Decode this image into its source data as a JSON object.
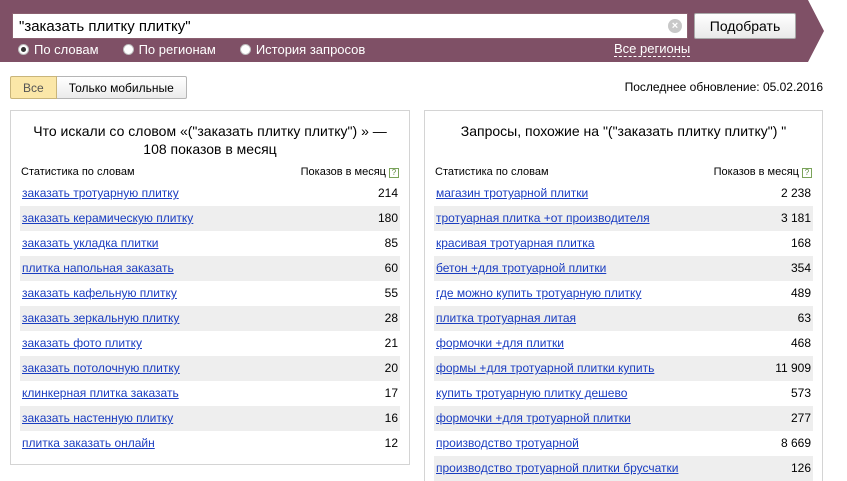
{
  "search": {
    "query": "\"заказать плитку плитку\"",
    "button_label": "Подобрать",
    "clear_glyph": "×"
  },
  "modes": [
    {
      "label": "По словам",
      "selected": true
    },
    {
      "label": "По регионам",
      "selected": false
    },
    {
      "label": "История запросов",
      "selected": false
    }
  ],
  "regions_link": "Все регионы",
  "filters": {
    "all_label": "Все",
    "mobile_label": "Только мобильные"
  },
  "last_update": "Последнее обновление: 05.02.2016",
  "left_panel": {
    "title": "Что искали со словом «(\"заказать плитку плитку\") » — 108 показов в месяц",
    "col_query": "Статистика по словам",
    "col_count": "Показов в месяц",
    "rows": [
      {
        "q": "заказать тротуарную плитку",
        "n": "214"
      },
      {
        "q": "заказать керамическую плитку",
        "n": "180"
      },
      {
        "q": "заказать укладка плитки",
        "n": "85"
      },
      {
        "q": "плитка напольная заказать",
        "n": "60"
      },
      {
        "q": "заказать кафельную плитку",
        "n": "55"
      },
      {
        "q": "заказать зеркальную плитку",
        "n": "28"
      },
      {
        "q": "заказать фото плитку",
        "n": "21"
      },
      {
        "q": "заказать потолочную плитку",
        "n": "20"
      },
      {
        "q": "клинкерная плитка заказать",
        "n": "17"
      },
      {
        "q": "заказать настенную плитку",
        "n": "16"
      },
      {
        "q": "плитка заказать онлайн",
        "n": "12"
      }
    ]
  },
  "right_panel": {
    "title": "Запросы, похожие на \"(\"заказать плитку плитку\") \"",
    "col_query": "Статистика по словам",
    "col_count": "Показов в месяц",
    "rows": [
      {
        "q": "магазин тротуарной плитки",
        "n": "2 238"
      },
      {
        "q": "тротуарная плитка +от производителя",
        "n": "3 181"
      },
      {
        "q": "красивая тротуарная плитка",
        "n": "168"
      },
      {
        "q": "бетон +для тротуарной плитки",
        "n": "354"
      },
      {
        "q": "где можно купить тротуарную плитку",
        "n": "489"
      },
      {
        "q": "плитка тротуарная литая",
        "n": "63"
      },
      {
        "q": "формочки +для плитки",
        "n": "468"
      },
      {
        "q": "формы +для тротуарной плитки купить",
        "n": "11 909"
      },
      {
        "q": "купить тротуарную плитку дешево",
        "n": "573"
      },
      {
        "q": "формочки +для тротуарной плитки",
        "n": "277"
      },
      {
        "q": "производство тротуарной",
        "n": "8 669"
      },
      {
        "q": "производство тротуарной плитки брусчатки",
        "n": "126"
      }
    ]
  },
  "colors": {
    "topbar": "#7f5066",
    "link": "#1a3dc1",
    "row_alt": "#eeeeee",
    "active_filter": "#fbe7a8"
  },
  "icons": {
    "clear": "clear-icon",
    "help": "help-icon"
  }
}
